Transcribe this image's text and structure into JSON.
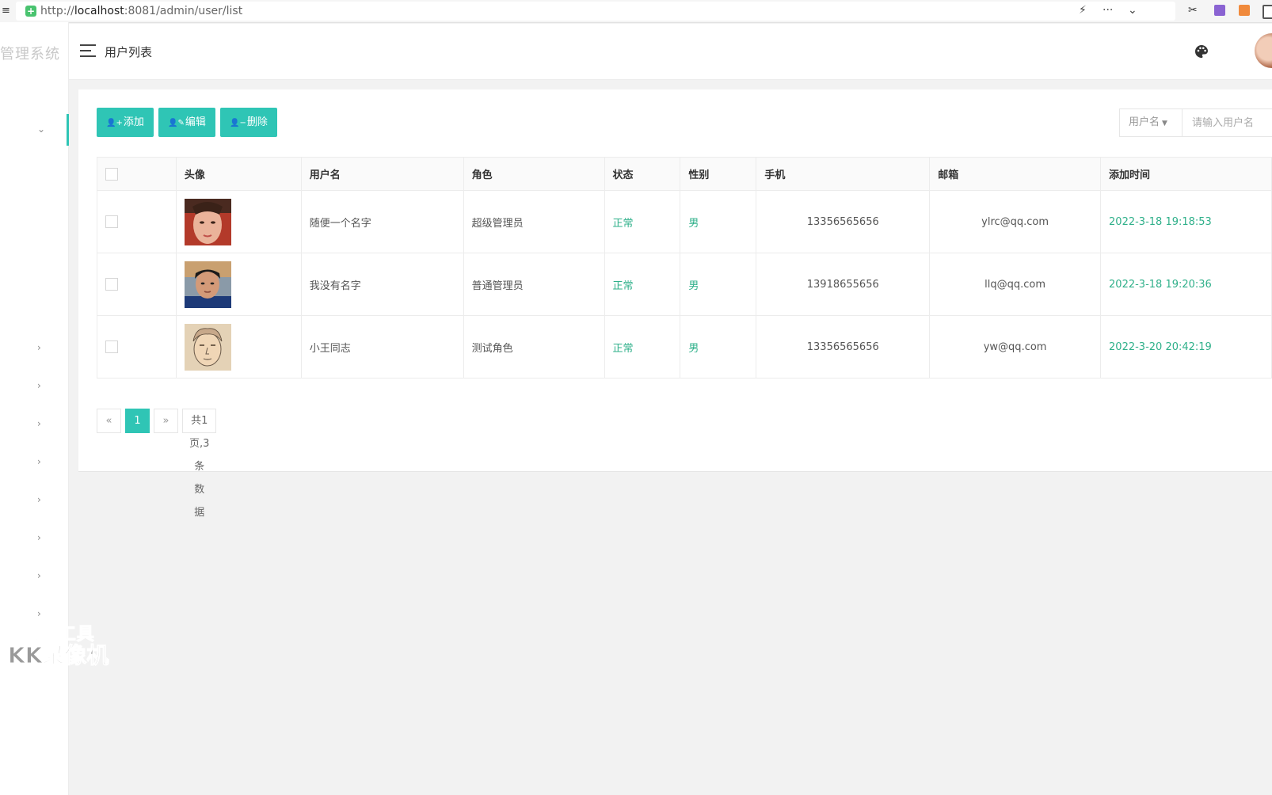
{
  "browser": {
    "url_prefix": "http://",
    "url_host": "localhost",
    "url_rest": ":8081/admin/user/list"
  },
  "sidebar": {
    "logo": "管理系统",
    "active_chevron": "⌄",
    "chevron": "›"
  },
  "header": {
    "title": "用户列表"
  },
  "toolbar": {
    "add_label": "添加",
    "edit_label": "编辑",
    "delete_label": "删除"
  },
  "search": {
    "field_select": "用户名",
    "placeholder": "请输入用户名"
  },
  "table": {
    "columns": [
      "头像",
      "用户名",
      "角色",
      "状态",
      "性别",
      "手机",
      "邮箱",
      "添加时间"
    ],
    "rows": [
      {
        "username": "随便一个名字",
        "role": "超级管理员",
        "status": "正常",
        "gender": "男",
        "phone": "13356565656",
        "email": "ylrc@qq.com",
        "created": "2022-3-18 19:18:53"
      },
      {
        "username": "我没有名字",
        "role": "普通管理员",
        "status": "正常",
        "gender": "男",
        "phone": "13918655656",
        "email": "llq@qq.com",
        "created": "2022-3-18 19:20:36"
      },
      {
        "username": "小王同志",
        "role": "测试角色",
        "status": "正常",
        "gender": "男",
        "phone": "13356565656",
        "email": "yw@qq.com",
        "created": "2022-3-20 20:42:19"
      }
    ]
  },
  "pagination": {
    "prev": "«",
    "current": "1",
    "next": "»",
    "summary": "共1页,3条数据"
  },
  "watermark": {
    "line1": "录制工具",
    "line2": "KK录像机"
  },
  "colors": {
    "accent": "#2fc5b5",
    "status_green": "#2fb08a"
  }
}
